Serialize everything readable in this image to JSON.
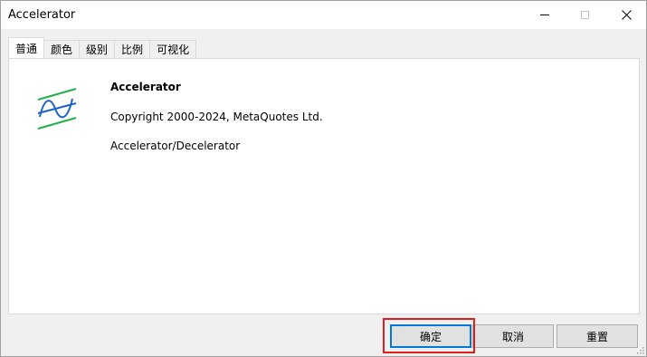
{
  "window": {
    "title": "Accelerator"
  },
  "tabs": [
    {
      "label": "普通",
      "active": true
    },
    {
      "label": "颜色",
      "active": false
    },
    {
      "label": "级别",
      "active": false
    },
    {
      "label": "比例",
      "active": false
    },
    {
      "label": "可视化",
      "active": false
    }
  ],
  "info": {
    "name": "Accelerator",
    "copyright": "Copyright 2000-2024, MetaQuotes Ltd.",
    "description": "Accelerator/Decelerator"
  },
  "buttons": {
    "ok": "确定",
    "cancel": "取消",
    "reset": "重置"
  },
  "colors": {
    "logo_green": "#22b04a",
    "logo_blue": "#1c64c8",
    "highlight_red": "#e02020",
    "focus_blue": "#0078d7"
  },
  "icons": [
    "minimize-icon",
    "maximize-icon",
    "close-icon",
    "indicator-logo-icon",
    "resize-grip-icon"
  ]
}
